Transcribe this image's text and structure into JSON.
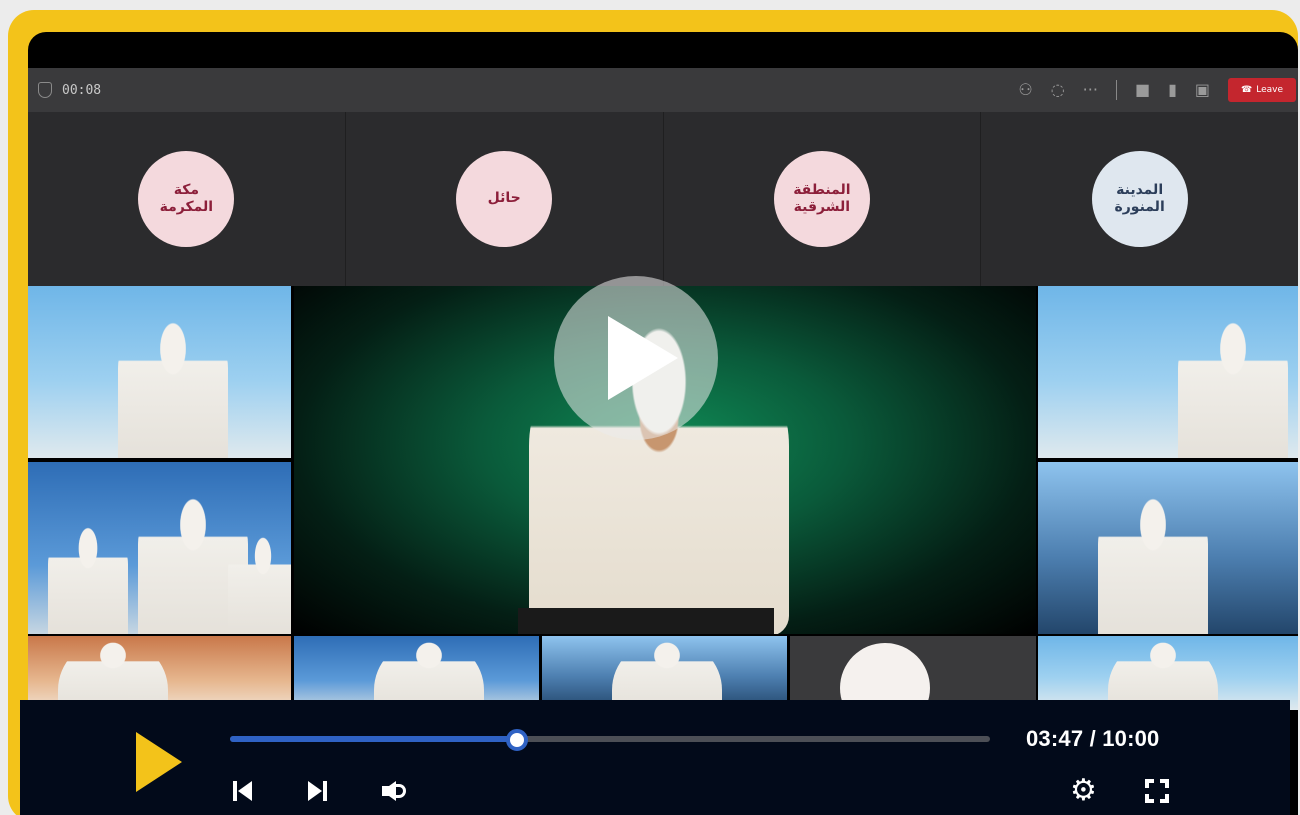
{
  "meeting": {
    "elapsed": "00:08",
    "leave_label": "Leave"
  },
  "regions": [
    {
      "label": "مكة المكرمة",
      "color": "pink"
    },
    {
      "label": "حائل",
      "color": "pink"
    },
    {
      "label": "المنطقة الشرقية",
      "color": "pink"
    },
    {
      "label": "المدينة المنورة",
      "color": "blue"
    }
  ],
  "player": {
    "time_display": "03:47 / 10:00",
    "current_time": "03:47",
    "duration": "10:00",
    "progress": 0.378,
    "accent_color": "#f3c31a",
    "progress_color": "#2f62c4"
  },
  "icons": {
    "gear": "⚙"
  }
}
